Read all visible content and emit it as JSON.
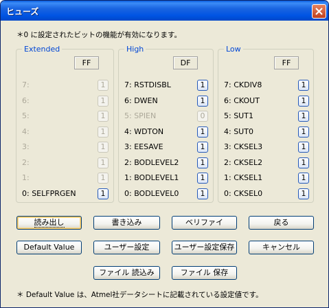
{
  "window": {
    "title": "ヒューズ"
  },
  "note": "＊0 に設定されたビットの機能が有効になります。",
  "footer_note": "＊ Default Value は、Atmel社データシートに記載されている設定値です。",
  "groups": [
    {
      "title": "Extended",
      "hex": "FF",
      "rows": [
        {
          "label": "7:",
          "value": "1",
          "enabled": false
        },
        {
          "label": "6:",
          "value": "1",
          "enabled": false
        },
        {
          "label": "5:",
          "value": "1",
          "enabled": false
        },
        {
          "label": "4:",
          "value": "1",
          "enabled": false
        },
        {
          "label": "3:",
          "value": "1",
          "enabled": false
        },
        {
          "label": "2:",
          "value": "1",
          "enabled": false
        },
        {
          "label": "1:",
          "value": "1",
          "enabled": false
        },
        {
          "label": "0: SELFPRGEN",
          "value": "1",
          "enabled": true
        }
      ]
    },
    {
      "title": "High",
      "hex": "DF",
      "rows": [
        {
          "label": "7: RSTDISBL",
          "value": "1",
          "enabled": true
        },
        {
          "label": "6: DWEN",
          "value": "1",
          "enabled": true
        },
        {
          "label": "5: SPIEN",
          "value": "0",
          "enabled": false
        },
        {
          "label": "4: WDTON",
          "value": "1",
          "enabled": true
        },
        {
          "label": "3: EESAVE",
          "value": "1",
          "enabled": true
        },
        {
          "label": "2: BODLEVEL2",
          "value": "1",
          "enabled": true
        },
        {
          "label": "1: BODLEVEL1",
          "value": "1",
          "enabled": true
        },
        {
          "label": "0: BODLEVEL0",
          "value": "1",
          "enabled": true
        }
      ]
    },
    {
      "title": "Low",
      "hex": "FF",
      "rows": [
        {
          "label": "7: CKDIV8",
          "value": "1",
          "enabled": true
        },
        {
          "label": "6: CKOUT",
          "value": "1",
          "enabled": true
        },
        {
          "label": "5: SUT1",
          "value": "1",
          "enabled": true
        },
        {
          "label": "4: SUT0",
          "value": "1",
          "enabled": true
        },
        {
          "label": "3: CKSEL3",
          "value": "1",
          "enabled": true
        },
        {
          "label": "2: CKSEL2",
          "value": "1",
          "enabled": true
        },
        {
          "label": "1: CKSEL1",
          "value": "1",
          "enabled": true
        },
        {
          "label": "0: CKSEL0",
          "value": "1",
          "enabled": true
        }
      ]
    }
  ],
  "buttons": {
    "read": "読み出し",
    "write": "書き込み",
    "verify": "ベリファイ",
    "back": "戻る",
    "default_value": "Default Value",
    "user_setting": "ユーザー設定",
    "save_user_setting": "ユーザー設定保存",
    "cancel": "キャンセル",
    "file_load": "ファイル 読込み",
    "file_save": "ファイル 保存"
  }
}
